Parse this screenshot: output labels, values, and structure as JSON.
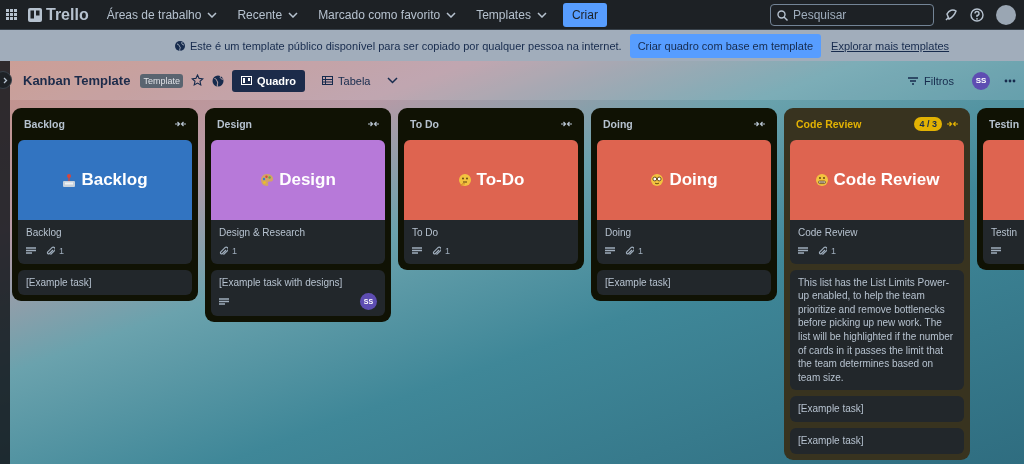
{
  "nav": {
    "logo": "Trello",
    "menus": [
      {
        "label": "Áreas de trabalho"
      },
      {
        "label": "Recente"
      },
      {
        "label": "Marcado como favorito"
      },
      {
        "label": "Templates"
      }
    ],
    "create_button": "Criar",
    "search": {
      "placeholder": "Pesquisar"
    }
  },
  "banner": {
    "text": "Este é um template público disponível para ser copiado por qualquer pessoa na internet.",
    "button": "Criar quadro com base em template",
    "link": "Explorar mais templates"
  },
  "board": {
    "title": "Kanban Template",
    "badge": "Template",
    "starred": false,
    "views": [
      {
        "label": "Quadro",
        "selected": true
      },
      {
        "label": "Tabela",
        "selected": false
      }
    ],
    "filter": "Filtros",
    "member": "SS"
  },
  "lists": [
    {
      "title": "Backlog",
      "over_limit": false,
      "cards": [
        {
          "cover": {
            "color": "#3274c1",
            "text": "Backlog"
          },
          "title": "Backlog",
          "description": true,
          "attachments": "1"
        },
        {
          "title": "[Example task]"
        }
      ]
    },
    {
      "title": "Design",
      "over_limit": false,
      "cards": [
        {
          "cover": {
            "color": "#b779d9",
            "text": "Design"
          },
          "title": "Design & Research",
          "description": false,
          "attachments": "1"
        },
        {
          "title": "[Example task with designs]",
          "description": true,
          "members": [
            "SS"
          ]
        }
      ]
    },
    {
      "title": "To Do",
      "over_limit": false,
      "cards": [
        {
          "cover": {
            "color": "#de6450",
            "text": "To-Do"
          },
          "title": "To Do",
          "description": true,
          "attachments": "1"
        }
      ]
    },
    {
      "title": "Doing",
      "over_limit": false,
      "cards": [
        {
          "cover": {
            "color": "#de6450",
            "text": "Doing"
          },
          "title": "Doing",
          "description": true,
          "attachments": "1"
        },
        {
          "title": "[Example task]"
        }
      ]
    },
    {
      "title": "Code Review",
      "limit": "4 / 3",
      "over_limit": true,
      "cards": [
        {
          "cover": {
            "color": "#de6450",
            "text": "Code Review"
          },
          "title": "Code Review",
          "description": true,
          "attachments": "1"
        },
        {
          "title": "This list has the List Limits Power-up enabled, to help the team prioritize and remove bottlenecks before picking up new work. The list will be highlighted if the number of cards in it passes the limit that the team determines based on team size."
        },
        {
          "title": "[Example task]"
        },
        {
          "title": "[Example task]"
        }
      ]
    },
    {
      "title": "Testin",
      "over_limit": false,
      "cards": [
        {
          "cover": {
            "color": "#de6450"
          },
          "title": "Testin",
          "description": true
        }
      ]
    }
  ]
}
